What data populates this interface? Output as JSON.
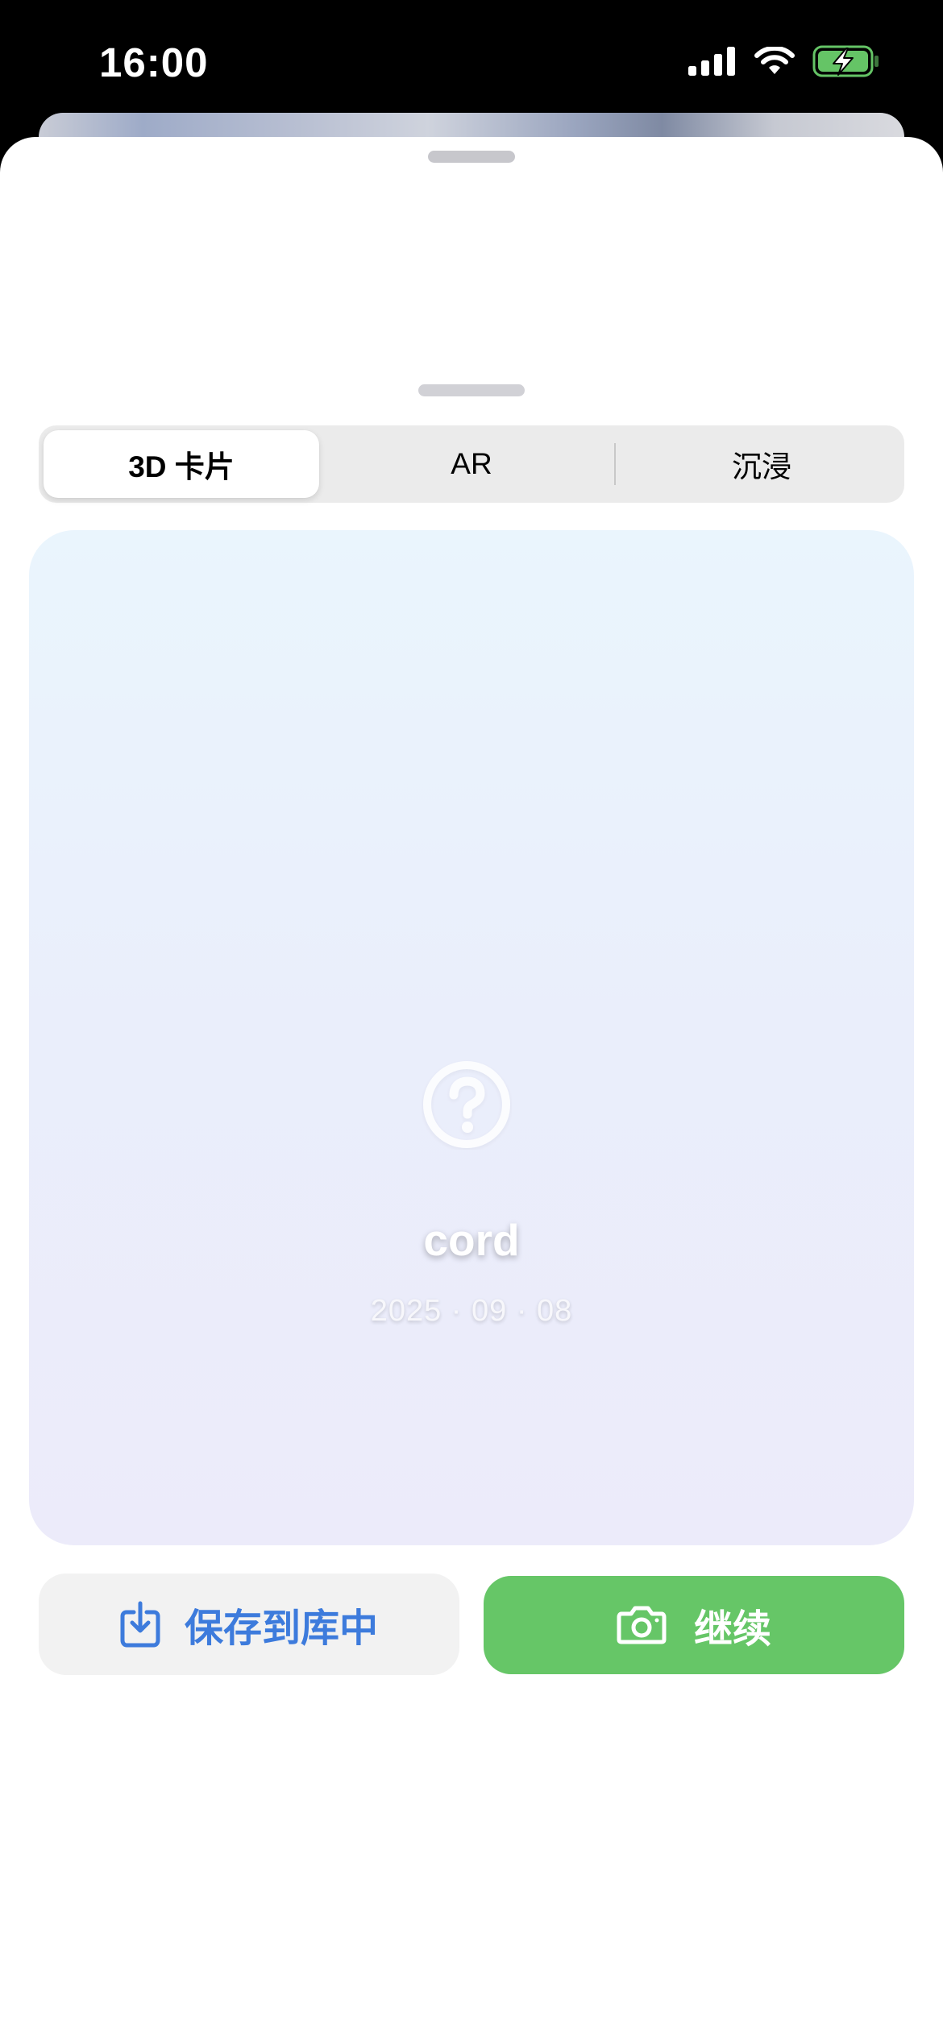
{
  "status_bar": {
    "time": "16:00",
    "icons": [
      "cellular-signal-icon",
      "wifi-icon",
      "battery-charging-icon"
    ]
  },
  "sheet": {
    "segmented_control": {
      "items": [
        {
          "label": "3D 卡片",
          "selected": true
        },
        {
          "label": "AR",
          "selected": false
        },
        {
          "label": "沉浸",
          "selected": false
        }
      ]
    },
    "card": {
      "icon": "question-circle-icon",
      "title": "cord",
      "date": "2025 · 09 · 08"
    },
    "buttons": {
      "save": {
        "label": "保存到库中",
        "icon": "download-tray-icon",
        "color": "#3d7bdc"
      },
      "continue": {
        "label": "继续",
        "icon": "camera-icon",
        "background": "#66c667"
      }
    }
  },
  "colors": {
    "accent_green": "#66c667",
    "accent_blue": "#3d7bdc",
    "battery_green": "#65c466"
  }
}
